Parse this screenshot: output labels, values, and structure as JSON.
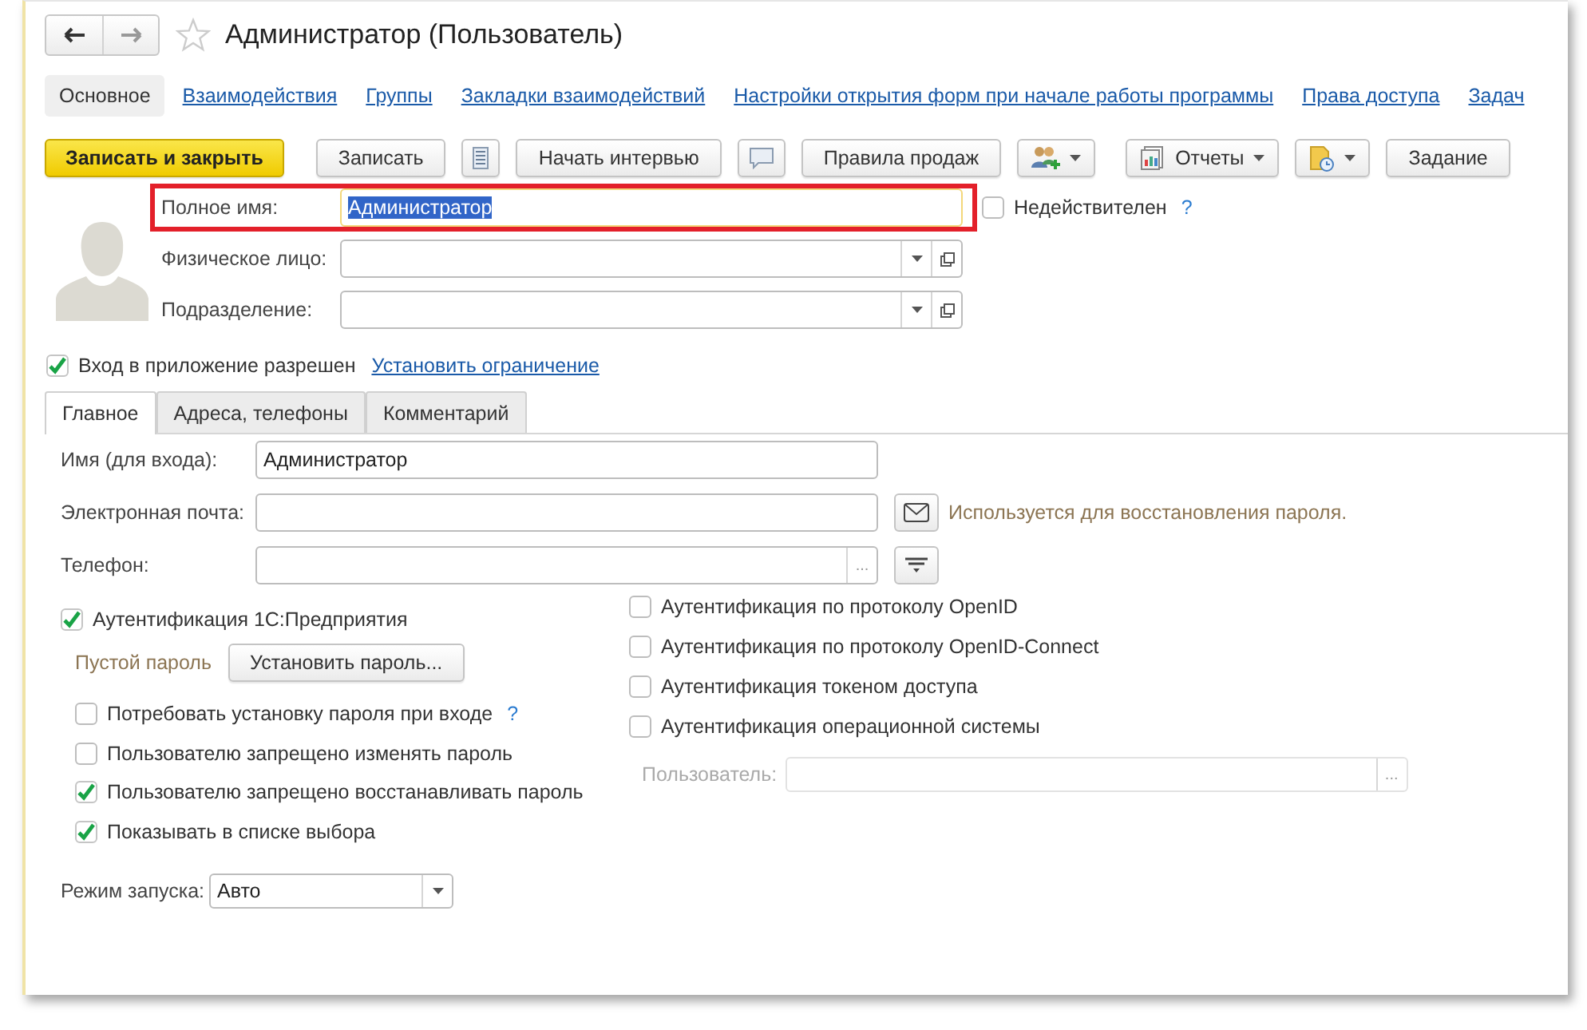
{
  "window": {
    "title": "Администратор (Пользователь)"
  },
  "nav_tabs": [
    {
      "label": "Основное",
      "selected": true
    },
    {
      "label": "Взаимодействия",
      "selected": false
    },
    {
      "label": "Группы",
      "selected": false
    },
    {
      "label": "Закладки взаимодействий",
      "selected": false
    },
    {
      "label": "Настройки открытия форм при начале работы программы",
      "selected": false
    },
    {
      "label": "Права доступа",
      "selected": false
    },
    {
      "label": "Задач",
      "selected": false
    }
  ],
  "toolbar": [
    {
      "kind": "primary",
      "label": "Записать и закрыть"
    },
    {
      "kind": "text",
      "label": "Записать"
    },
    {
      "kind": "notes"
    },
    {
      "kind": "text",
      "label": "Начать интервью"
    },
    {
      "kind": "comment"
    },
    {
      "kind": "text",
      "label": "Правила продаж"
    },
    {
      "kind": "people"
    },
    {
      "kind": "reports",
      "label": "Отчеты"
    },
    {
      "kind": "docs"
    },
    {
      "kind": "text",
      "label": "Задание"
    }
  ],
  "header": {
    "full_name": {
      "label": "Полное имя:",
      "value": "Администратор",
      "text_selected": true,
      "highlighted": true
    },
    "invalid": {
      "label": "Недействителен",
      "checked": false,
      "help": "?"
    },
    "fields": [
      {
        "label": "Физическое лицо:"
      },
      {
        "label": "Подразделение:"
      }
    ]
  },
  "login": {
    "label": "Вход в приложение разрешен",
    "checked": true,
    "link": "Установить ограничение"
  },
  "form_tabs": [
    {
      "label": "Главное",
      "selected": true
    },
    {
      "label": "Адреса, телефоны",
      "selected": false
    },
    {
      "label": "Комментарий",
      "selected": false
    }
  ],
  "main": {
    "login_name": {
      "label": "Имя (для входа):",
      "value": "Администратор"
    },
    "email": {
      "label": "Электронная почта:",
      "hint": "Используется для восстановления пароля."
    },
    "phone": {
      "label": "Телефон:",
      "choice": "..."
    },
    "auth_1c": {
      "label": "Аутентификация 1С:Предприятия",
      "checked": true
    },
    "password_status": "Пустой пароль",
    "set_password": "Установить пароль...",
    "options": [
      {
        "label": "Потребовать установку пароля при входе",
        "checked": false,
        "help": "?"
      },
      {
        "label": "Пользователю запрещено изменять пароль",
        "checked": false
      },
      {
        "label": "Пользователю запрещено восстанавливать пароль",
        "checked": true
      },
      {
        "label": "Показывать в списке выбора",
        "checked": true
      }
    ],
    "auth_other": [
      {
        "label": "Аутентификация по протоколу OpenID",
        "checked": false
      },
      {
        "label": "Аутентификация по протоколу OpenID-Connect",
        "checked": false
      },
      {
        "label": "Аутентификация токеном доступа",
        "checked": false
      },
      {
        "label": "Аутентификация операционной системы",
        "checked": false
      }
    ],
    "os_user": {
      "label": "Пользователь:",
      "choice": "...",
      "disabled": true
    },
    "launch_mode": {
      "label": "Режим запуска:",
      "value": "Авто"
    }
  }
}
